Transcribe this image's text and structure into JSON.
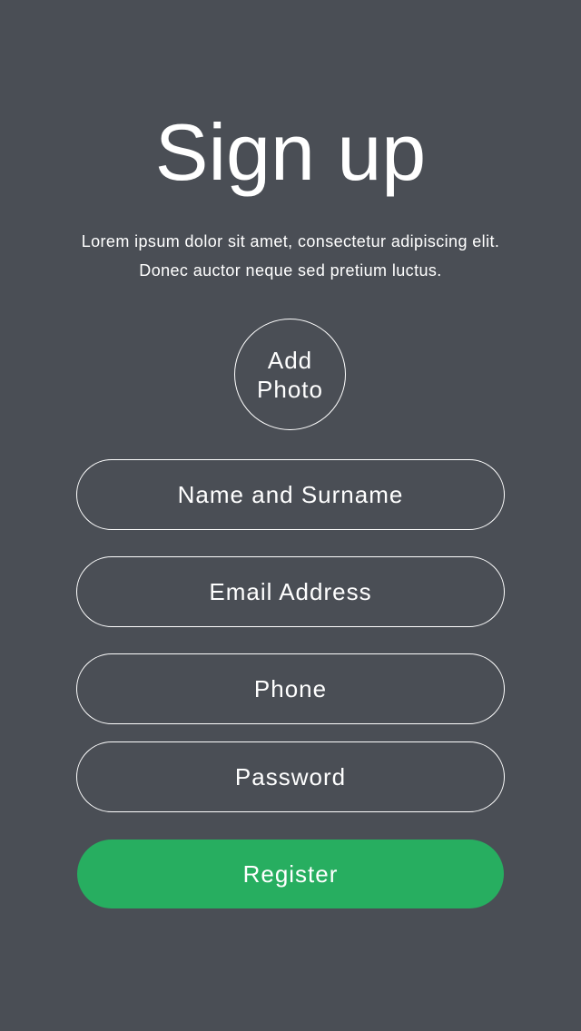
{
  "header": {
    "title": "Sign up",
    "subtitle_line1": "Lorem ipsum dolor sit amet, consectetur adipiscing elit.",
    "subtitle_line2": "Donec auctor neque sed pretium luctus."
  },
  "photo": {
    "line1": "Add",
    "line2": "Photo"
  },
  "form": {
    "name_placeholder": "Name and Surname",
    "email_placeholder": "Email Address",
    "phone_placeholder": "Phone",
    "password_placeholder": "Password",
    "register_label": "Register"
  },
  "colors": {
    "background": "#4a4e55",
    "accent": "#27ae60",
    "text": "#ffffff"
  }
}
